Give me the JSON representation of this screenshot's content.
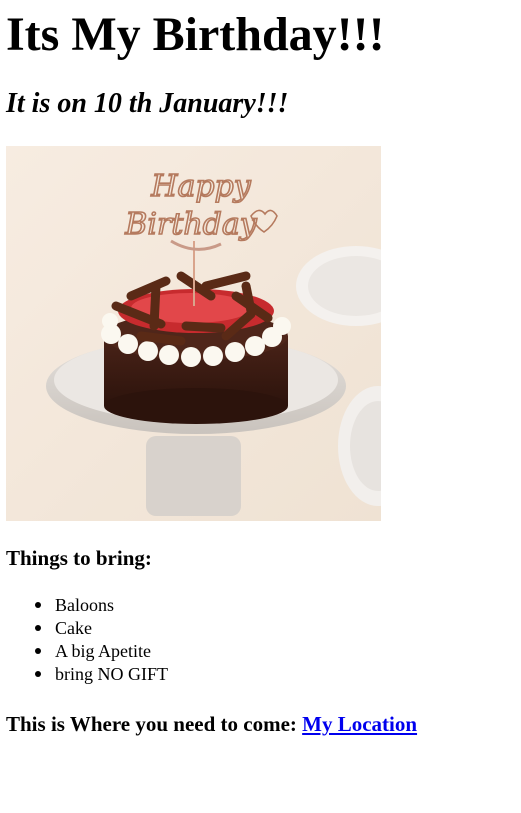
{
  "heading": "Its My Birthday!!!",
  "subheading": "It is on 10 th January!!!",
  "image": {
    "alt": "Birthday cake",
    "topper_text": "Happy Birthday"
  },
  "things_title": "Things to bring:",
  "things": [
    {
      "label": "Baloons"
    },
    {
      "label": "Cake"
    },
    {
      "label": "A big Apetite"
    },
    {
      "label": "bring NO GIFT"
    }
  ],
  "location": {
    "prefix": "This is Where you need to come: ",
    "link_text": "My Location",
    "link_color": "#0000ee"
  }
}
